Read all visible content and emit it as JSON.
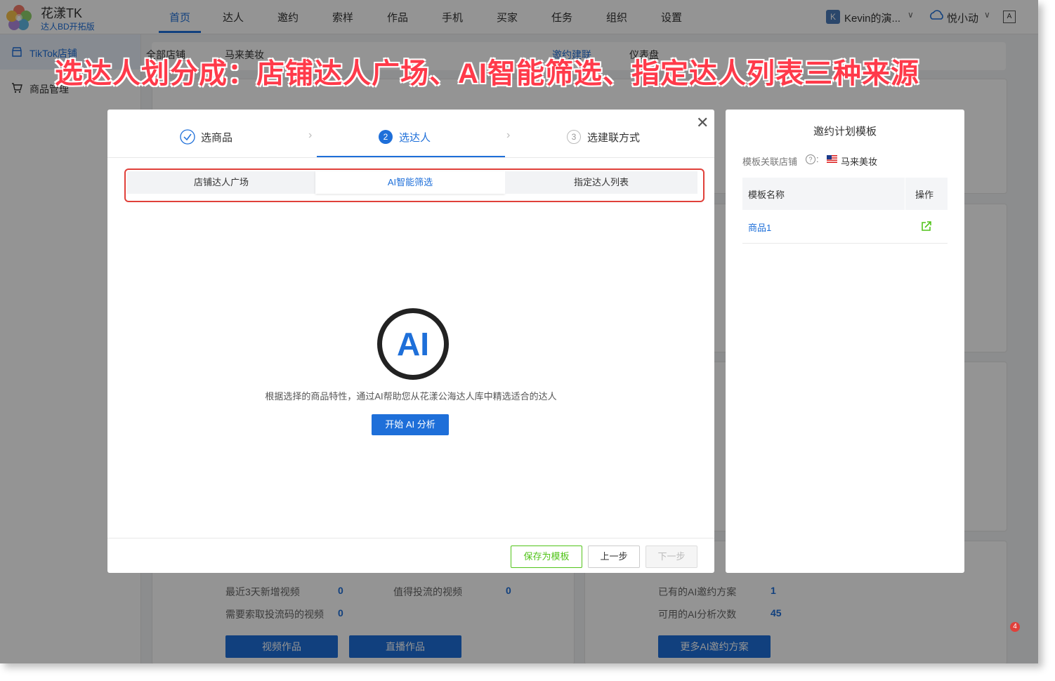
{
  "app": {
    "brand": "花漾TK",
    "brand_sub": "达人BD开拓版"
  },
  "nav": {
    "items": [
      "首页",
      "达人",
      "邀约",
      "索样",
      "作品",
      "手机",
      "买家",
      "任务",
      "组织",
      "设置"
    ],
    "active_index": 0
  },
  "user": {
    "initial": "K",
    "name": "Kevin的演...",
    "team": "悦小动",
    "lang_icon": "translate-icon"
  },
  "sidebar": {
    "items": [
      "TikTok店铺",
      "商品管理"
    ]
  },
  "background": {
    "breadcrumb": "全部店铺",
    "store": "马来美妆",
    "tabs": [
      "邀约建联",
      "仪表盘"
    ],
    "stats_left": [
      {
        "label": "最近3天新增视频",
        "value": "0"
      },
      {
        "label": "值得投流的视频",
        "value": "0"
      },
      {
        "label": "需要索取投流码的视频",
        "value": "0"
      }
    ],
    "stats_right": [
      {
        "label": "已有的AI邀约方案",
        "value": "1"
      },
      {
        "label": "可用的AI分析次数",
        "value": "45"
      }
    ],
    "buttons": [
      "视频作品",
      "直播作品",
      "更多AI邀约方案"
    ],
    "notification_count": "4"
  },
  "banner": {
    "text": "选达人划分成：店铺达人广场、AI智能筛选、指定达人列表三种来源"
  },
  "modal": {
    "steps": [
      {
        "num": "✓",
        "label": "选商品",
        "state": "done"
      },
      {
        "num": "2",
        "label": "选达人",
        "state": "active"
      },
      {
        "num": "3",
        "label": "选建联方式",
        "state": "pending"
      }
    ],
    "segments": [
      "店铺达人广场",
      "AI智能筛选",
      "指定达人列表"
    ],
    "active_segment": 1,
    "ai_logo": "AI",
    "ai_description": "根据选择的商品特性，通过AI帮助您从花漾公海达人库中精选适合的达人",
    "ai_button": "开始 AI 分析",
    "footer": {
      "save_template": "保存为模板",
      "prev": "上一步",
      "next": "下一步"
    }
  },
  "template_panel": {
    "title": "邀约计划模板",
    "store_label": "模板关联店铺",
    "store_name": "马来美妆",
    "columns": [
      "模板名称",
      "操作"
    ],
    "rows": [
      {
        "name": "商品1"
      }
    ]
  },
  "colors": {
    "accent": "#1e6fd9",
    "banner_red": "#ff3a4a",
    "highlight_border": "#e0403a",
    "save_green": "#52c41a"
  }
}
